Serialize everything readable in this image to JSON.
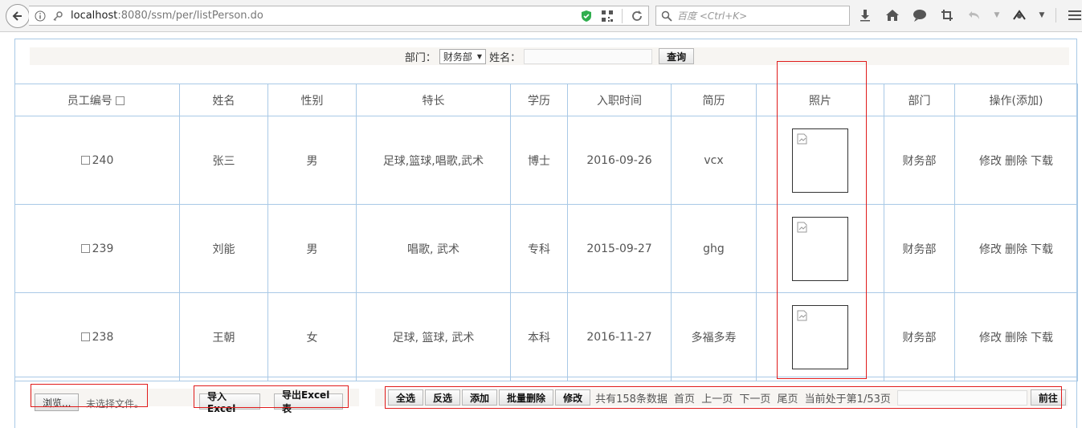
{
  "browser": {
    "url_host": "localhost",
    "url_rest": ":8080/ssm/per/listPerson.do",
    "search_placeholder": "百度 <Ctrl+K>"
  },
  "query": {
    "dept_label": "部门：",
    "dept_selected": "财务部",
    "name_label": "姓名：",
    "name_value": "",
    "search_button": "查询"
  },
  "table": {
    "headers": [
      "员工编号",
      "姓名",
      "性别",
      "特长",
      "学历",
      "入职时间",
      "简历",
      "照片",
      "部门",
      "操作(添加)"
    ],
    "rows": [
      {
        "id": "240",
        "name": "张三",
        "gender": "男",
        "skills": "足球,篮球,唱歌,武术",
        "education": "博士",
        "hire_date": "2016-09-26",
        "resume": "vcx",
        "dept": "财务部",
        "op_edit": "修改",
        "op_delete": "删除",
        "op_download": "下载"
      },
      {
        "id": "239",
        "name": "刘能",
        "gender": "男",
        "skills": "唱歌, 武术",
        "education": "专科",
        "hire_date": "2015-09-27",
        "resume": "ghg",
        "dept": "财务部",
        "op_edit": "修改",
        "op_delete": "删除",
        "op_download": "下载"
      },
      {
        "id": "238",
        "name": "王朝",
        "gender": "女",
        "skills": "足球, 篮球, 武术",
        "education": "本科",
        "hire_date": "2016-11-27",
        "resume": "多福多寿",
        "dept": "财务部",
        "op_edit": "修改",
        "op_delete": "删除",
        "op_download": "下载"
      }
    ]
  },
  "footer": {
    "browse_button": "浏览...",
    "no_file_label": "未选择文件。",
    "import_button": "导入Excel",
    "export_button": "导出Excel表",
    "select_all_button": "全选",
    "invert_button": "反选",
    "add_button": "添加",
    "batch_delete_button": "批量删除",
    "edit_button": "修改",
    "total_text": "共有158条数据",
    "first_page": "首页",
    "prev_page": "上一页",
    "next_page": "下一页",
    "last_page": "尾页",
    "current_page_text": "当前处于第1/53页",
    "goto_button": "前往"
  },
  "colors": {
    "grid_border": "#a9c9e6",
    "annotation_red": "#e01b1b",
    "bar_background": "#f7f5f2"
  }
}
